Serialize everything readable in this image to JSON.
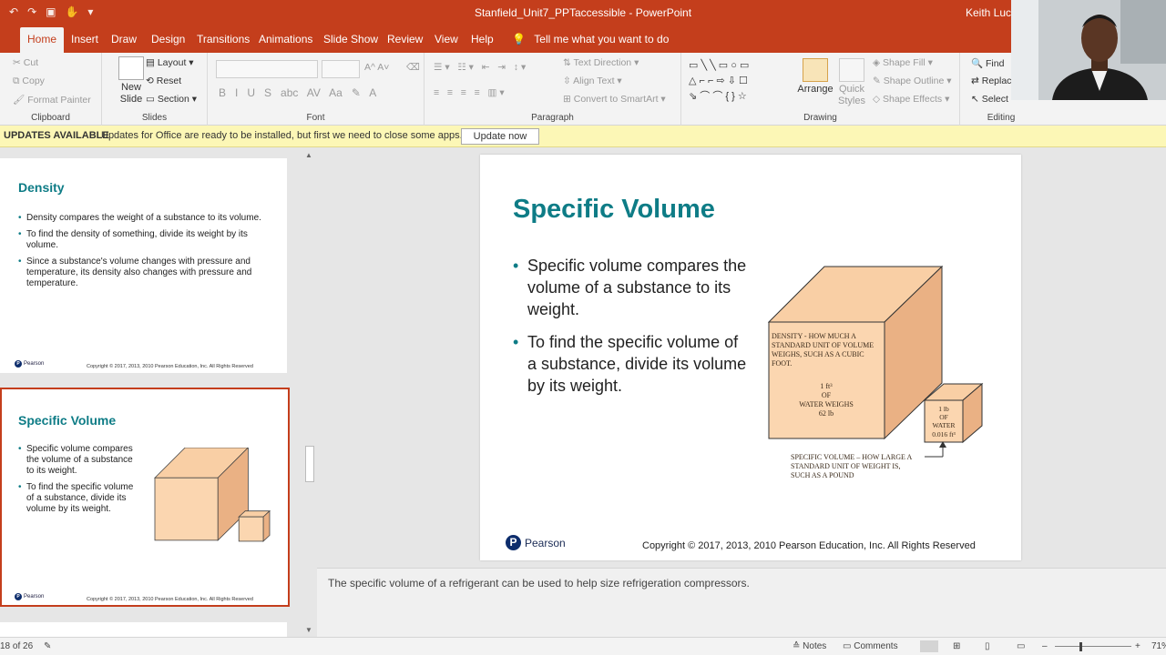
{
  "window": {
    "title": "Stanfield_Unit7_PPTaccessible  -  PowerPoint",
    "user": "Keith Lucas"
  },
  "tabs": [
    "Home",
    "Insert",
    "Draw",
    "Design",
    "Transitions",
    "Animations",
    "Slide Show",
    "Review",
    "View",
    "Help"
  ],
  "tell_me": "Tell me what you want to do",
  "ribbon": {
    "clipboard": {
      "label": "Clipboard",
      "cut": "Cut",
      "copy": "Copy",
      "format_painter": "Format Painter"
    },
    "slides": {
      "label": "Slides",
      "new_slide": "New Slide",
      "layout": "Layout",
      "reset": "Reset",
      "section": "Section"
    },
    "font": {
      "label": "Font"
    },
    "paragraph": {
      "label": "Paragraph",
      "text_direction": "Text Direction",
      "align_text": "Align Text",
      "convert_smartart": "Convert to SmartArt"
    },
    "drawing": {
      "label": "Drawing",
      "arrange": "Arrange",
      "quick_styles": "Quick Styles",
      "shape_fill": "Shape Fill",
      "shape_outline": "Shape Outline",
      "shape_effects": "Shape Effects"
    },
    "editing": {
      "label": "Editing",
      "find": "Find",
      "replace": "Replac",
      "select": "Select"
    }
  },
  "update_bar": {
    "title": "UPDATES AVAILABLE",
    "message": "Updates for Office are ready to be installed, but first we need to close some apps.",
    "button": "Update now"
  },
  "thumbnails": [
    {
      "title": "Density",
      "bullets": [
        "Density compares the weight of a substance to its volume.",
        "To find the density of something, divide its weight by its volume.",
        "Since a substance's volume changes with pressure and temperature, its density also changes with pressure and temperature."
      ],
      "logo": "Pearson",
      "copyright": "Copyright © 2017, 2013, 2010 Pearson Education, Inc. All Rights Reserved"
    },
    {
      "title": "Specific Volume",
      "bullets": [
        "Specific volume compares the volume of a substance to its weight.",
        "To find the specific volume of a substance, divide its volume by its weight."
      ],
      "logo": "Pearson",
      "copyright": "Copyright © 2017, 2013, 2010 Pearson Education, Inc. All Rights Reserved"
    }
  ],
  "slide": {
    "title": "Specific Volume",
    "bullets": [
      "Specific volume compares the volume of a substance to its weight.",
      "To find the specific volume of a substance, divide its volume by its weight."
    ],
    "figure": {
      "big_cube_lines": [
        "DENSITY - HOW MUCH A",
        "STANDARD UNIT OF VOLUME",
        "WEIGHS, SUCH AS A CUBIC",
        "FOOT."
      ],
      "big_cube_value": [
        "1 ft³",
        "OF",
        "WATER WEIGHS",
        "62 lb"
      ],
      "small_cube_value": [
        "1 lb",
        "OF",
        "WATER",
        "0.016 ft³"
      ],
      "caption": [
        "SPECIFIC VOLUME – HOW LARGE A",
        "STANDARD UNIT OF WEIGHT IS,",
        "SUCH AS A POUND"
      ]
    },
    "logo": "Pearson",
    "copyright": "Copyright © 2017, 2013, 2010 Pearson Education, Inc. All Rights Reserved"
  },
  "notes_text": "The specific volume of a refrigerant can be used to help size refrigeration compressors.",
  "status": {
    "slide_count": "18 of 26",
    "notes": "Notes",
    "comments": "Comments",
    "zoom": "71%"
  },
  "colors": {
    "accent": "#c43e1c",
    "title_teal": "#0e7c86",
    "cube_fill": "#f9cfa5",
    "update_bar": "#fcf7b6"
  }
}
